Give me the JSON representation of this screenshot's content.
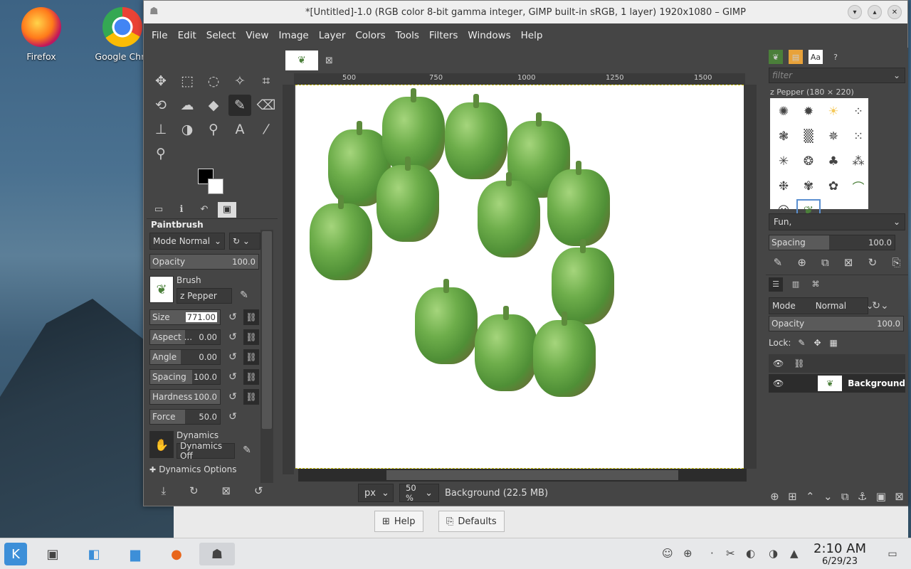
{
  "desktop": {
    "icons": [
      {
        "label": "Firefox",
        "icon": "firefox-icon"
      },
      {
        "label": "Google Chro",
        "icon": "chrome-icon"
      }
    ]
  },
  "window": {
    "title": "*[Untitled]-1.0 (RGB color 8-bit gamma integer, GIMP built-in sRGB, 1 layer) 1920x1080 – GIMP",
    "menus": [
      "File",
      "Edit",
      "Select",
      "View",
      "Image",
      "Layer",
      "Colors",
      "Tools",
      "Filters",
      "Windows",
      "Help"
    ]
  },
  "tool_options": {
    "title": "Paintbrush",
    "mode_label": "Mode",
    "mode_value": "Normal",
    "opacity": {
      "label": "Opacity",
      "value": "100.0"
    },
    "brush_label": "Brush",
    "brush_name": "z Pepper",
    "size": {
      "label": "Size",
      "value": "771.00"
    },
    "aspect": {
      "label": "Aspect ...",
      "value": "0.00"
    },
    "angle": {
      "label": "Angle",
      "value": "0.00"
    },
    "spacing": {
      "label": "Spacing",
      "value": "100.0"
    },
    "hardness": {
      "label": "Hardness",
      "value": "100.0"
    },
    "force": {
      "label": "Force",
      "value": "50.0"
    },
    "dynamics_label": "Dynamics",
    "dynamics_value": "Dynamics Off",
    "dynamics_options": "Dynamics Options"
  },
  "canvas": {
    "ruler_ticks": [
      "500",
      "750",
      "1000",
      "1250",
      "1500"
    ],
    "unit": "px",
    "zoom": "50 %",
    "status": "Background (22.5 MB)"
  },
  "brushes_panel": {
    "filter_placeholder": "filter",
    "brush_info": "z Pepper (180 × 220)",
    "tag": "Fun,",
    "spacing": {
      "label": "Spacing",
      "value": "100.0"
    }
  },
  "layers_panel": {
    "mode_label": "Mode",
    "mode_value": "Normal",
    "opacity": {
      "label": "Opacity",
      "value": "100.0"
    },
    "lock_label": "Lock:",
    "layer_name": "Background"
  },
  "dialog_buttons": {
    "help": "Help",
    "defaults": "Defaults"
  },
  "taskbar": {
    "time": "2:10 AM",
    "date": "6/29/23"
  }
}
